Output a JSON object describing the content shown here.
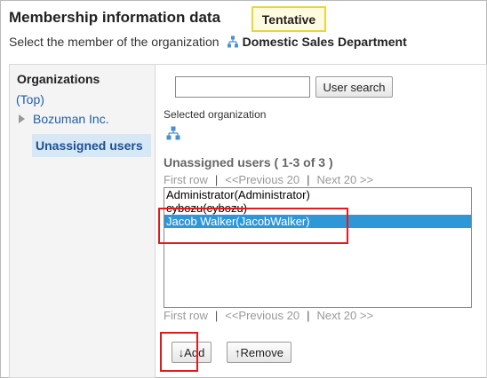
{
  "header": {
    "title": "Membership information data",
    "badge": "Tentative",
    "subtitle_prefix": "Select the member of the organization",
    "department": "Domestic Sales Department"
  },
  "tree": {
    "heading": "Organizations",
    "top_link": "(Top)",
    "items": [
      {
        "label": "Bozuman Inc.",
        "expandable": true
      },
      {
        "label": "Unassigned users",
        "selected": true
      }
    ]
  },
  "search": {
    "value": "",
    "button_label": "User search"
  },
  "selected_org": {
    "label": "Selected organization"
  },
  "users": {
    "heading": "Unassigned users ( 1-3 of 3 )",
    "pager": {
      "first": "First row",
      "sep": "|",
      "prev": "<<Previous 20",
      "next": "Next 20 >>"
    },
    "list": [
      {
        "label": "Administrator(Administrator)",
        "selected": false
      },
      {
        "label": "cybozu(cybozu)",
        "selected": false
      },
      {
        "label": "Jacob Walker(JacobWalker)",
        "selected": true
      }
    ]
  },
  "actions": {
    "add_label": "↓Add",
    "remove_label": "↑Remove"
  },
  "colors": {
    "badge_border": "#e8d63c",
    "link": "#1f5fa8",
    "selection": "#2e97d8",
    "highlight": "#e01b1b"
  }
}
